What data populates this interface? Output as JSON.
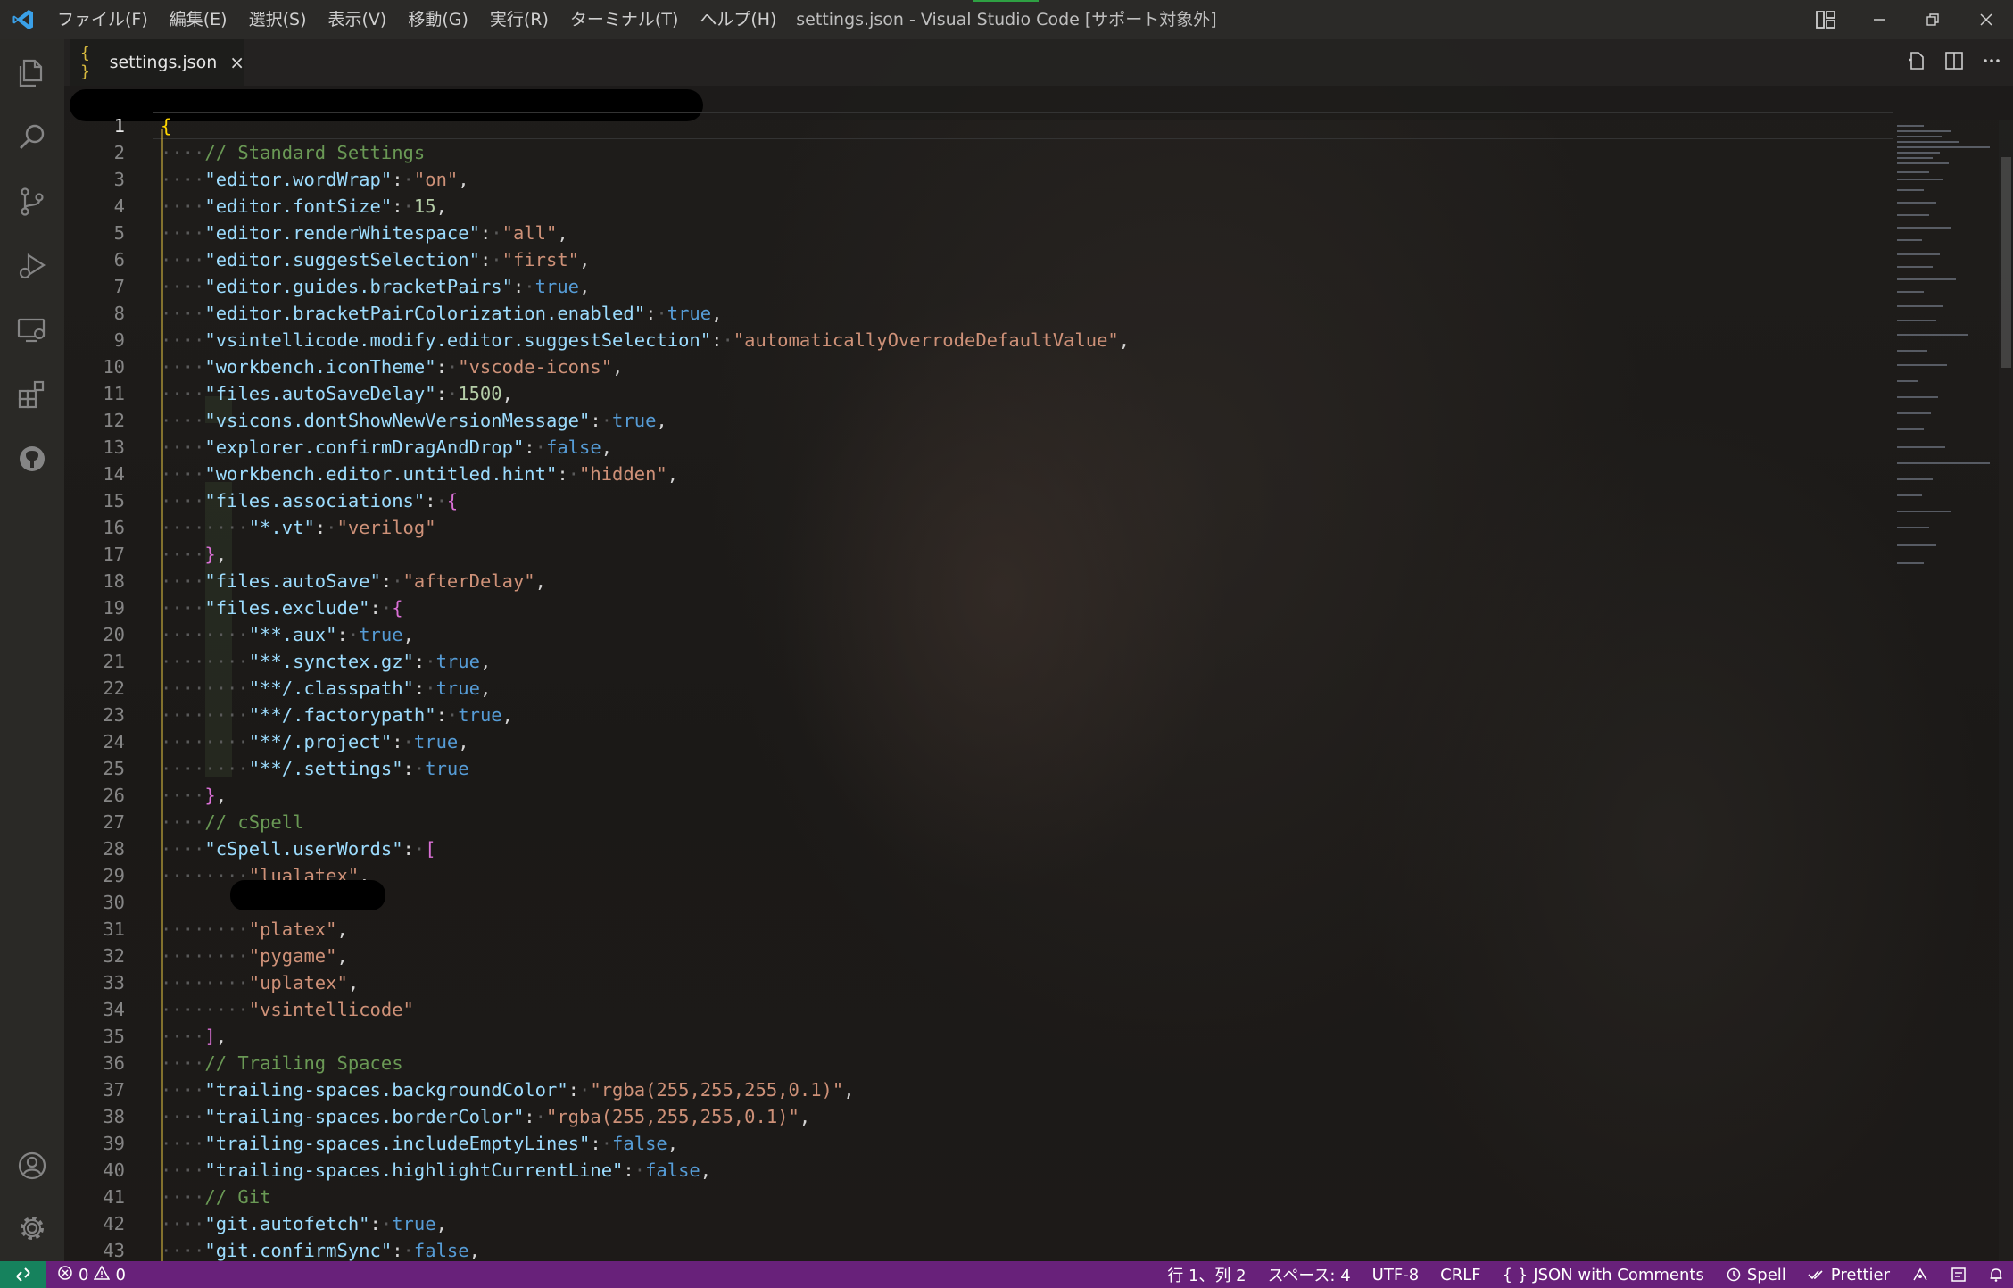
{
  "window": {
    "title": "settings.json - Visual Studio Code [サポート対象外]",
    "menu": [
      "ファイル(F)",
      "編集(E)",
      "選択(S)",
      "表示(V)",
      "移動(G)",
      "実行(R)",
      "ターミナル(T)",
      "ヘルプ(H)"
    ]
  },
  "activity_bar": {
    "icons": [
      "explorer-icon",
      "search-icon",
      "source-control-icon",
      "run-debug-icon",
      "remote-explorer-icon",
      "extensions-icon",
      "github-icon"
    ],
    "bottom_icons": [
      "account-icon",
      "settings-gear-icon"
    ]
  },
  "editor": {
    "tab": {
      "icon_text": "{ }",
      "label": "settings.json",
      "close": "×"
    },
    "lines": [
      {
        "n": "1"
      },
      {
        "n": "2"
      },
      {
        "n": "3"
      },
      {
        "n": "4"
      },
      {
        "n": "5"
      },
      {
        "n": "6"
      },
      {
        "n": "7"
      },
      {
        "n": "8"
      },
      {
        "n": "9"
      },
      {
        "n": "10"
      },
      {
        "n": "11"
      },
      {
        "n": "12"
      },
      {
        "n": "13"
      },
      {
        "n": "14"
      },
      {
        "n": "15"
      },
      {
        "n": "16"
      },
      {
        "n": "17"
      },
      {
        "n": "18"
      },
      {
        "n": "19"
      },
      {
        "n": "20"
      },
      {
        "n": "21"
      },
      {
        "n": "22"
      },
      {
        "n": "23"
      },
      {
        "n": "24"
      },
      {
        "n": "25"
      },
      {
        "n": "26"
      },
      {
        "n": "27"
      },
      {
        "n": "28"
      },
      {
        "n": "29"
      },
      {
        "n": "30"
      },
      {
        "n": "31"
      },
      {
        "n": "32"
      },
      {
        "n": "33"
      },
      {
        "n": "34"
      },
      {
        "n": "35"
      },
      {
        "n": "36"
      },
      {
        "n": "37"
      },
      {
        "n": "38"
      },
      {
        "n": "39"
      },
      {
        "n": "40"
      },
      {
        "n": "41"
      },
      {
        "n": "42"
      },
      {
        "n": "43"
      }
    ],
    "code": {
      "l2": "// Standard Settings",
      "l3k": "\"editor.wordWrap\"",
      "l3v": "\"on\"",
      "l4k": "\"editor.fontSize\"",
      "l4v": "15",
      "l5k": "\"editor.renderWhitespace\"",
      "l5v": "\"all\"",
      "l6k": "\"editor.suggestSelection\"",
      "l6v": "\"first\"",
      "l7k": "\"editor.guides.bracketPairs\"",
      "l7v": "true",
      "l8k": "\"editor.bracketPairColorization.enabled\"",
      "l8v": "true",
      "l9k": "\"vsintellicode.modify.editor.suggestSelection\"",
      "l9v": "\"automaticallyOverrodeDefaultValue\"",
      "l10k": "\"workbench.iconTheme\"",
      "l10v": "\"vscode-icons\"",
      "l11k": "\"files.autoSaveDelay\"",
      "l11v": "1500",
      "l12k": "\"vsicons.dontShowNewVersionMessage\"",
      "l12v": "true",
      "l13k": "\"explorer.confirmDragAndDrop\"",
      "l13v": "false",
      "l14k": "\"workbench.editor.untitled.hint\"",
      "l14v": "\"hidden\"",
      "l15k": "\"files.associations\"",
      "l16k": "\"*.vt\"",
      "l16v": "\"verilog\"",
      "l18k": "\"files.autoSave\"",
      "l18v": "\"afterDelay\"",
      "l19k": "\"files.exclude\"",
      "l20k": "\"**.aux\"",
      "l20v": "true",
      "l21k": "\"**.synctex.gz\"",
      "l21v": "true",
      "l22k": "\"**/.classpath\"",
      "l22v": "true",
      "l23k": "\"**/.factorypath\"",
      "l23v": "true",
      "l24k": "\"**/.project\"",
      "l24v": "true",
      "l25k": "\"**/.settings\"",
      "l25v": "true",
      "l27": "// cSpell",
      "l28k": "\"cSpell.userWords\"",
      "l29v": "\"lualatex\"",
      "l31v": "\"platex\"",
      "l32v": "\"pygame\"",
      "l33v": "\"uplatex\"",
      "l34v": "\"vsintellicode\"",
      "l36": "// Trailing Spaces",
      "l37k": "\"trailing-spaces.backgroundColor\"",
      "l37v": "\"rgba(255,255,255,0.1)\"",
      "l38k": "\"trailing-spaces.borderColor\"",
      "l38v": "\"rgba(255,255,255,0.1)\"",
      "l39k": "\"trailing-spaces.includeEmptyLines\"",
      "l39v": "false",
      "l40k": "\"trailing-spaces.highlightCurrentLine\"",
      "l40v": "false",
      "l41": "// Git",
      "l42k": "\"git.autofetch\"",
      "l42v": "true",
      "l43k": "\"git.confirmSync\"",
      "l43v": "false"
    }
  },
  "status_bar": {
    "errors": "0",
    "warnings": "0",
    "position": "行 1、列 2",
    "indent": "スペース: 4",
    "encoding": "UTF-8",
    "eol": "CRLF",
    "language": "JSON with Comments",
    "spell": "Spell",
    "prettier": "Prettier"
  },
  "colors": {
    "status_bar": "#68217a",
    "remote_indicator": "#16825d",
    "key": "#9cdcfe",
    "string": "#ce9178",
    "number": "#b5cea8",
    "boolean": "#569cd6",
    "comment": "#6a9955"
  }
}
